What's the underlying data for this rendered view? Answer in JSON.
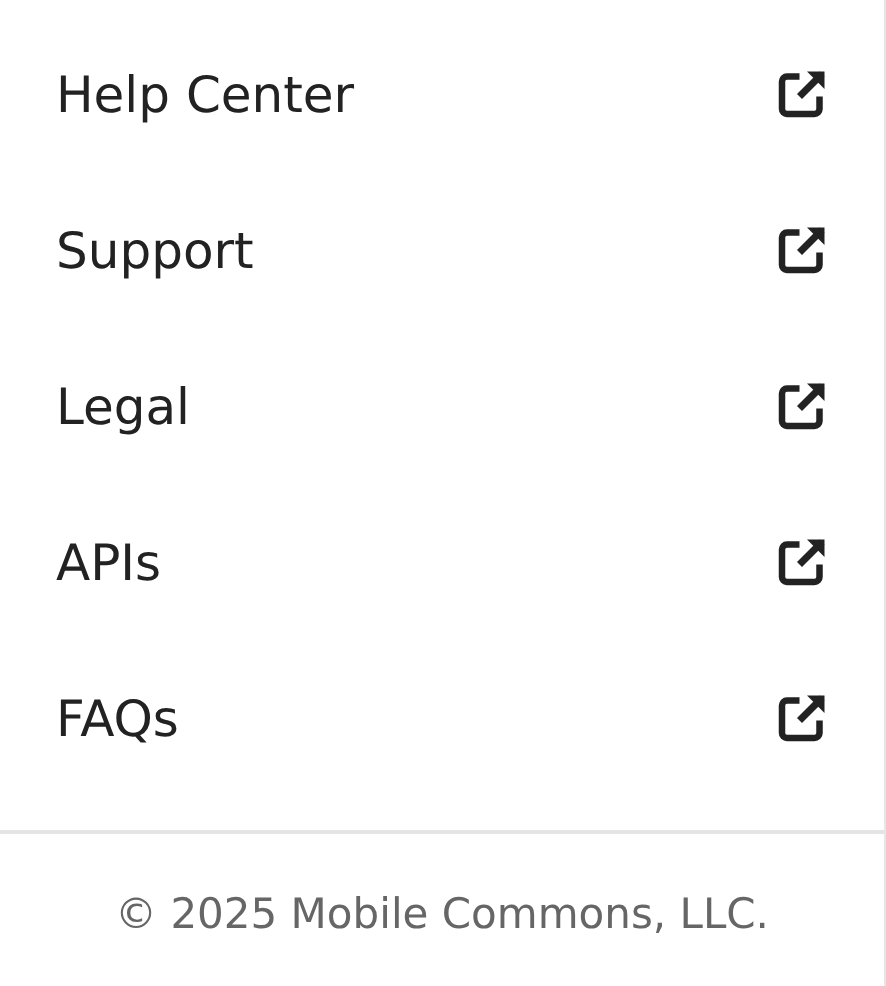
{
  "menu_items": [
    {
      "label": "Help Center"
    },
    {
      "label": "Support"
    },
    {
      "label": "Legal"
    },
    {
      "label": "APIs"
    },
    {
      "label": "FAQs"
    }
  ],
  "footer": "© 2025 Mobile Commons, LLC."
}
